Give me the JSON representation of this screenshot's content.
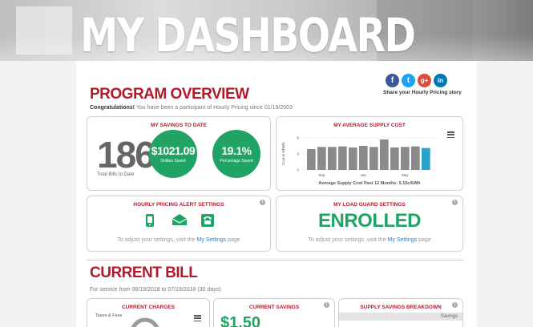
{
  "banner": {
    "title": "MY DASHBOARD"
  },
  "program_overview": {
    "title": "PROGRAM OVERVIEW",
    "congrats_bold": "Congratulations!",
    "congrats_text": " You have been a participant of Hourly Pricing since 01/19/2003"
  },
  "social": {
    "share_text": "Share your Hourly Pricing story",
    "icons": [
      {
        "name": "facebook-icon",
        "glyph": "f",
        "color": "#3b5998"
      },
      {
        "name": "twitter-icon",
        "glyph": "t",
        "color": "#1da1f2"
      },
      {
        "name": "google-plus-icon",
        "glyph": "g+",
        "color": "#dd4b39"
      },
      {
        "name": "linkedin-icon",
        "glyph": "in",
        "color": "#0077b5"
      }
    ]
  },
  "savings_to_date": {
    "title": "MY SAVINGS TO DATE",
    "bills": "186",
    "bills_label": "Total Bills to Date",
    "dollars_value": "$1021.09",
    "dollars_label": "Dollars Saved",
    "percent_value": "19.1%",
    "percent_label": "Percentage Saved",
    "colors": {
      "circle": "#21a366"
    }
  },
  "avg_supply_cost": {
    "title": "MY AVERAGE SUPPLY COST",
    "footer": "Average Supply Cost Past 12 Months: 5.15c/kWh"
  },
  "chart_data": {
    "type": "bar",
    "title": "MY AVERAGE SUPPLY COST",
    "ylabel": "Cost in ¢/kWh",
    "yticks": [
      "0",
      "3",
      "6"
    ],
    "xticks": [
      "Sep",
      "Jan",
      "May"
    ],
    "values": [
      3.9,
      4.3,
      4.3,
      4.4,
      4.2,
      4.5,
      4.3,
      5.7,
      4.2,
      4.3,
      4.4,
      4.1
    ],
    "highlight_last": true,
    "ylim": [
      0,
      6
    ],
    "grid": true,
    "colors": {
      "bar": "#8a8a8a",
      "last": "#2aa3c8"
    }
  },
  "alert_settings": {
    "title": "HOURLY PRICING ALERT SETTINGS",
    "text_before": "To adjust your settings, visit the ",
    "link": "My Settings",
    "text_after": " page"
  },
  "load_guard": {
    "title": "MY LOAD GUARD SETTINGS",
    "status": "ENROLLED",
    "text_before": "To adjust your settings, visit the ",
    "link": "My Settings",
    "text_after": " page"
  },
  "current_bill": {
    "title": "CURRENT BILL",
    "service_period": "For service from 06/19/2018 to 07/19/2018 (30 days)"
  },
  "current_charges": {
    "title": "CURRENT CHARGES",
    "taxes_label": "Taxes & Fees"
  },
  "current_savings": {
    "title": "CURRENT SAVINGS",
    "amount": "$1.50"
  },
  "supply_breakdown": {
    "title": "SUPPLY SAVINGS BREAKDOWN",
    "savings_label": "Savings"
  }
}
